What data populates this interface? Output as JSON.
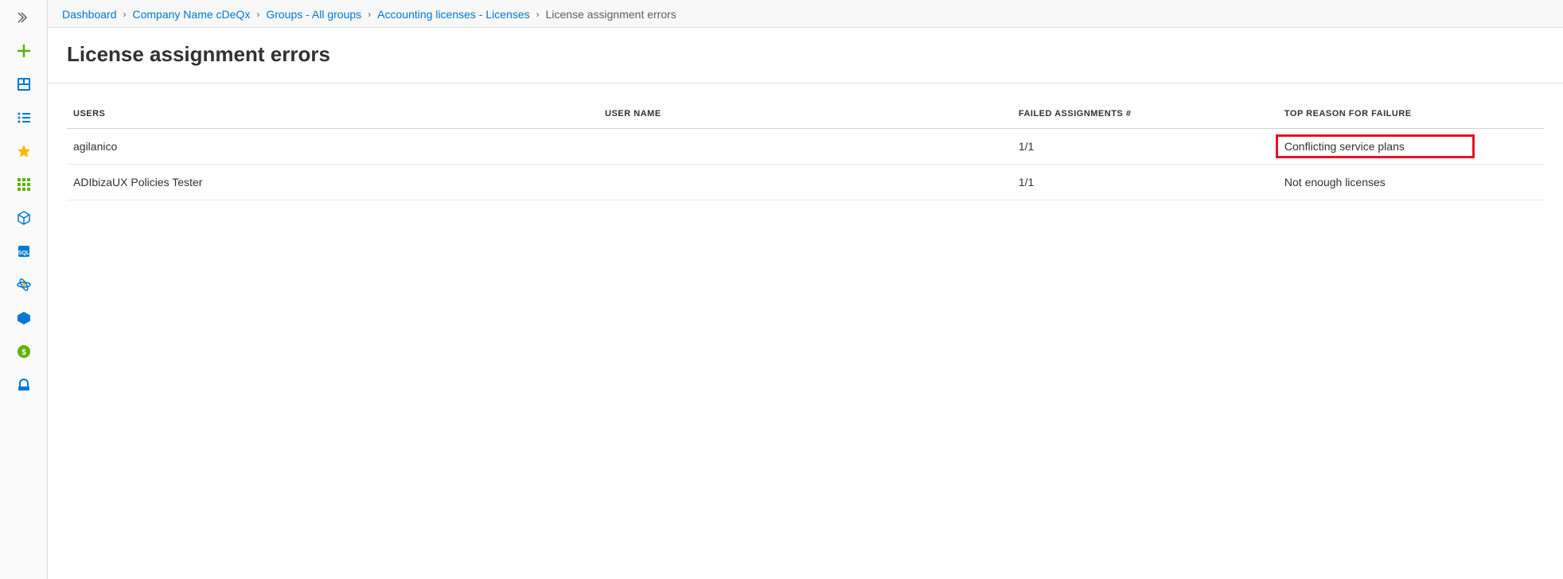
{
  "breadcrumb": {
    "items": [
      {
        "label": "Dashboard"
      },
      {
        "label": "Company Name cDeQx"
      },
      {
        "label": "Groups - All groups"
      },
      {
        "label": "Accounting licenses - Licenses"
      }
    ],
    "current": "License assignment errors"
  },
  "page": {
    "title": "License assignment errors"
  },
  "table": {
    "headers": {
      "users": "USERS",
      "username": "USER NAME",
      "failed": "FAILED ASSIGNMENTS #",
      "reason": "TOP REASON FOR FAILURE"
    },
    "rows": [
      {
        "users": "agilanico",
        "username": "",
        "failed": "1/1",
        "reason": "Conflicting service plans",
        "highlighted": true
      },
      {
        "users": "ADIbizaUX Policies Tester",
        "username": "",
        "failed": "1/1",
        "reason": "Not enough licenses",
        "highlighted": false
      }
    ]
  },
  "sidebar": {
    "items": [
      {
        "name": "expand-icon"
      },
      {
        "name": "create-icon"
      },
      {
        "name": "dashboard-icon"
      },
      {
        "name": "list-icon"
      },
      {
        "name": "star-icon"
      },
      {
        "name": "grid-icon"
      },
      {
        "name": "cube-icon"
      },
      {
        "name": "sql-icon"
      },
      {
        "name": "cosmos-icon"
      },
      {
        "name": "devops-icon"
      },
      {
        "name": "cost-icon"
      },
      {
        "name": "support-icon"
      }
    ]
  }
}
